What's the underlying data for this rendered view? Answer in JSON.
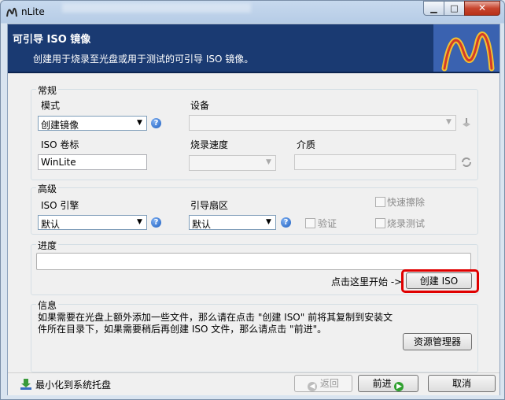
{
  "window": {
    "title": "nLite"
  },
  "header": {
    "title": "可引导 ISO 镜像",
    "subtitle": "创建用于烧录至光盘或用于测试的可引导 ISO 镜像。"
  },
  "general": {
    "legend": "常规",
    "mode_label": "模式",
    "mode_value": "创建镜像",
    "device_label": "设备",
    "device_value": "",
    "iso_label_label": "ISO 卷标",
    "iso_label_value": "WinLite",
    "burn_speed_label": "烧录速度",
    "burn_speed_value": "",
    "media_label": "介质",
    "media_value": ""
  },
  "advanced": {
    "legend": "高级",
    "engine_label": "ISO 引擎",
    "engine_value": "默认",
    "boot_sector_label": "引导扇区",
    "boot_sector_value": "默认",
    "verify_label": "验证",
    "quick_erase_label": "快速擦除",
    "burn_test_label": "烧录测试"
  },
  "progress": {
    "legend": "进度",
    "hint": "点击这里开始 ->",
    "create_iso_label": "创建 ISO"
  },
  "info": {
    "legend": "信息",
    "text_line1": "如果需要在光盘上额外添加一些文件，那么请在点击 \"创建 ISO\" 前将其复制到安装文",
    "text_line2": "件所在目录下，如果需要稍后再创建 ISO 文件，那么请点击 \"前进\"。",
    "explorer_label": "资源管理器"
  },
  "footer": {
    "minimize_to_tray": "最小化到系统托盘",
    "back_label": "返回",
    "next_label": "前进",
    "cancel_label": "取消"
  }
}
